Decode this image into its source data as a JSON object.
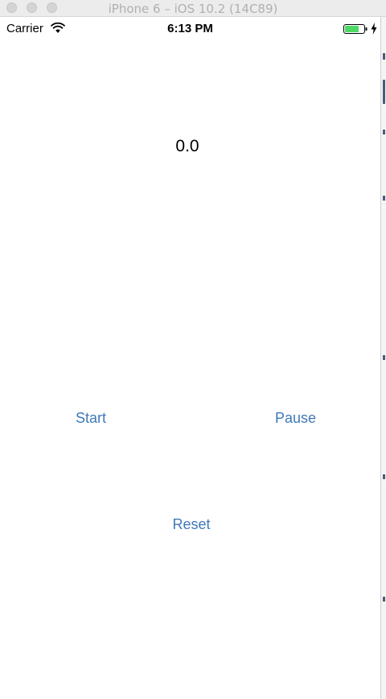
{
  "window": {
    "title": "iPhone 6 – iOS 10.2 (14C89)"
  },
  "status_bar": {
    "carrier": "Carrier",
    "time": "6:13 PM",
    "wifi_icon": "wifi-icon",
    "battery_icon": "battery-icon",
    "charging_icon": "bolt-icon"
  },
  "timer": {
    "value": "0.0"
  },
  "controls": {
    "start_label": "Start",
    "pause_label": "Pause",
    "reset_label": "Reset"
  },
  "colors": {
    "button_tint": "#3f78b9",
    "battery_fill": "#4cd964"
  }
}
